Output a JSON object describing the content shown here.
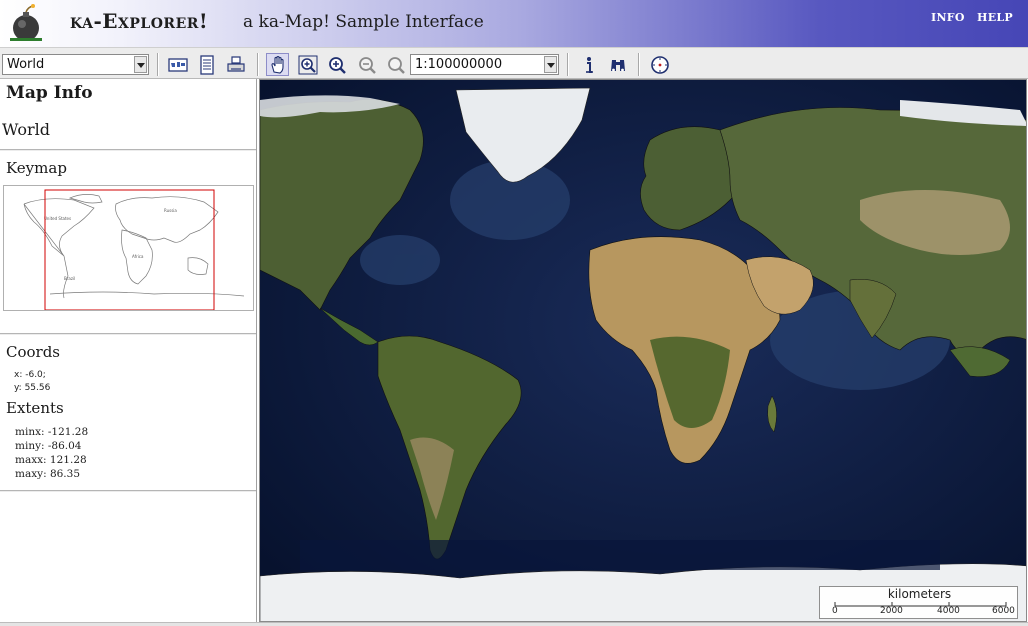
{
  "header": {
    "title": "ka-Explorer!",
    "subtitle": "a ka-Map! Sample Interface",
    "links": {
      "info": "INFO",
      "help": "HELP"
    }
  },
  "toolbar": {
    "map_select": {
      "value": "World"
    },
    "scale_select": {
      "value": "1:100000000"
    },
    "icons": [
      "reference-map-icon",
      "legend-icon",
      "print-icon",
      "pan-hand-icon",
      "zoom-box-icon",
      "zoom-in-icon",
      "zoom-out-icon",
      "zoom-extent-icon",
      "query-info-icon",
      "search-binoculars-icon",
      "compass-icon"
    ]
  },
  "sidebar": {
    "map_info": {
      "title": "Map Info",
      "name": "World"
    },
    "keymap": {
      "title": "Keymap"
    },
    "coords": {
      "title": "Coords",
      "x": "x: -6.0;",
      "y": "y: 55.56"
    },
    "extents": {
      "title": "Extents",
      "minx": "minx: -121.28",
      "miny": "miny: -86.04",
      "maxx": "maxx: 121.28",
      "maxy": "maxy: 86.35"
    }
  },
  "scalebar": {
    "unit": "kilometers",
    "ticks": [
      "0",
      "2000",
      "4000",
      "6000"
    ]
  },
  "colors": {
    "header_gradient_end": "#4646b6",
    "ocean": "#0b1a3e",
    "land": "#5a6a3a",
    "desert": "#b99a68",
    "ice": "#f4f4f6",
    "keymap_box": "#d00000"
  }
}
